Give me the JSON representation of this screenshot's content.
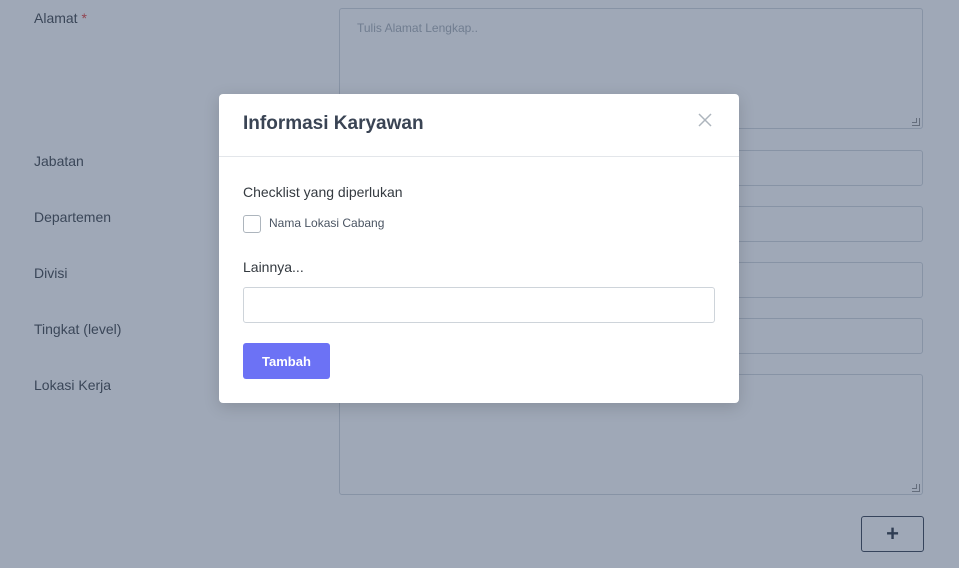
{
  "form": {
    "fields": [
      {
        "label": "Alamat",
        "required_mark": "*",
        "placeholder": "Tulis Alamat Lengkap.."
      },
      {
        "label": "Jabatan"
      },
      {
        "label": "Departemen"
      },
      {
        "label": "Divisi"
      },
      {
        "label": "Tingkat (level)"
      },
      {
        "label": "Lokasi Kerja"
      }
    ],
    "add_button_label": "+"
  },
  "modal": {
    "title": "Informasi Karyawan",
    "checklist_label": "Checklist yang diperlukan",
    "checklist_items": [
      {
        "label": "Nama Lokasi Cabang",
        "checked": false
      }
    ],
    "other_label": "Lainnya...",
    "other_value": "",
    "submit_label": "Tambah",
    "close_icon": "close-icon"
  },
  "colors": {
    "primary_button": "#6c72f5",
    "required": "#e3342f",
    "overlay": "rgba(63, 82, 112, 0.5)"
  }
}
